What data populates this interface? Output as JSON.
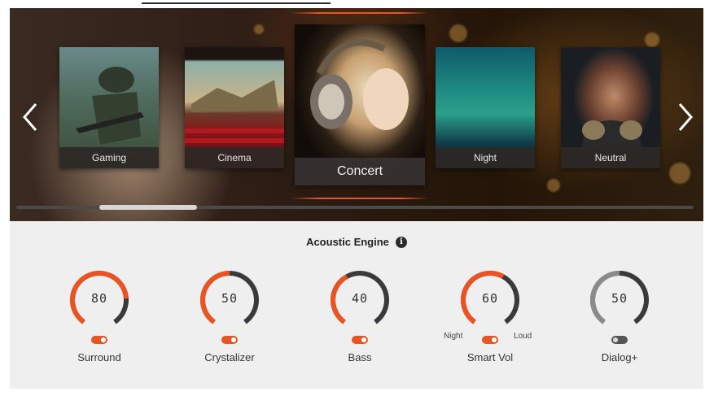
{
  "carousel": {
    "prev_icon": "chevron-left-icon",
    "next_icon": "chevron-right-icon",
    "presets": [
      {
        "label": "Gaming"
      },
      {
        "label": "Cinema"
      },
      {
        "label": "Concert",
        "selected": true
      },
      {
        "label": "Night"
      },
      {
        "label": "Neutral"
      }
    ]
  },
  "engine": {
    "title": "Acoustic Engine",
    "info_icon": "i",
    "accent_color": "#e95422",
    "knobs": [
      {
        "name": "Surround",
        "value": "80",
        "level": 0.8,
        "enabled": true
      },
      {
        "name": "Crystalizer",
        "value": "50",
        "level": 0.5,
        "enabled": true
      },
      {
        "name": "Bass",
        "value": "40",
        "level": 0.4,
        "enabled": true
      },
      {
        "name": "Smart Vol",
        "value": "60",
        "level": 0.6,
        "enabled": true,
        "left_label": "Night",
        "right_label": "Loud"
      },
      {
        "name": "Dialog+",
        "value": "50",
        "level": 0.5,
        "enabled": false
      }
    ]
  }
}
